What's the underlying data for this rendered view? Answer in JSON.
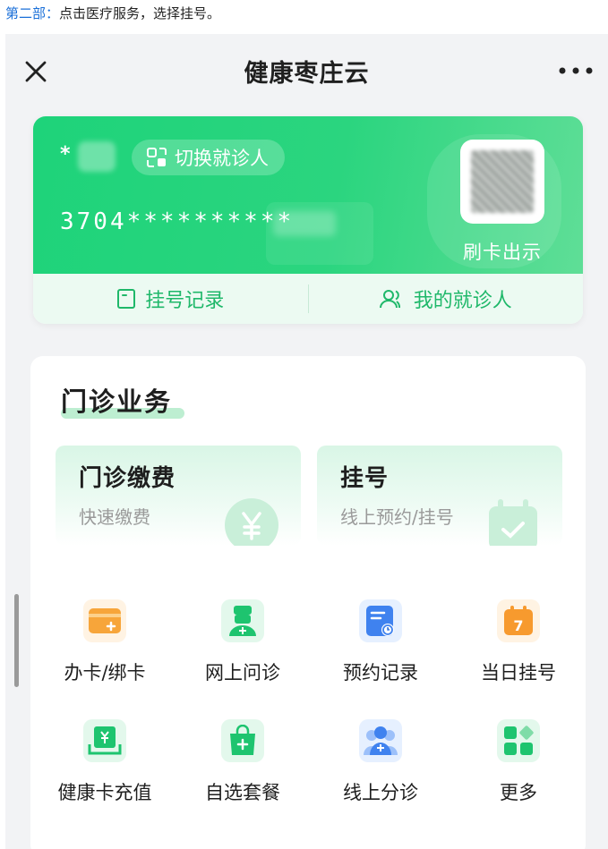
{
  "caption": {
    "lead": "第二部：",
    "text": "点击医疗服务，选择挂号。"
  },
  "nav": {
    "title": "健康枣庄云",
    "close_icon": "close-icon",
    "more_icon": "more-icon"
  },
  "card": {
    "name_prefix": "*",
    "switch_label": "切换就诊人",
    "id_number": "3704**********",
    "qr_label": "刷卡出示",
    "bottom": {
      "records_label": "挂号记录",
      "patients_label": "我的就诊人"
    },
    "colors": {
      "brand_green": "#22d17a",
      "accent_text": "#1fb86a"
    }
  },
  "outpatient": {
    "title": "门诊业务",
    "tiles": [
      {
        "title": "门诊缴费",
        "subtitle": "快速缴费",
        "icon": "yuan-icon"
      },
      {
        "title": "挂号",
        "subtitle": "线上预约/挂号",
        "icon": "calendar-check-icon"
      }
    ],
    "grid": [
      {
        "label": "办卡/绑卡",
        "icon": "card-add-icon"
      },
      {
        "label": "网上问诊",
        "icon": "doctor-icon"
      },
      {
        "label": "预约记录",
        "icon": "schedule-record-icon"
      },
      {
        "label": "当日挂号",
        "icon": "calendar-today-icon"
      },
      {
        "label": "健康卡充值",
        "icon": "recharge-icon"
      },
      {
        "label": "自选套餐",
        "icon": "package-icon"
      },
      {
        "label": "线上分诊",
        "icon": "triage-icon"
      },
      {
        "label": "更多",
        "icon": "more-apps-icon"
      }
    ],
    "calendar_day": "7"
  }
}
